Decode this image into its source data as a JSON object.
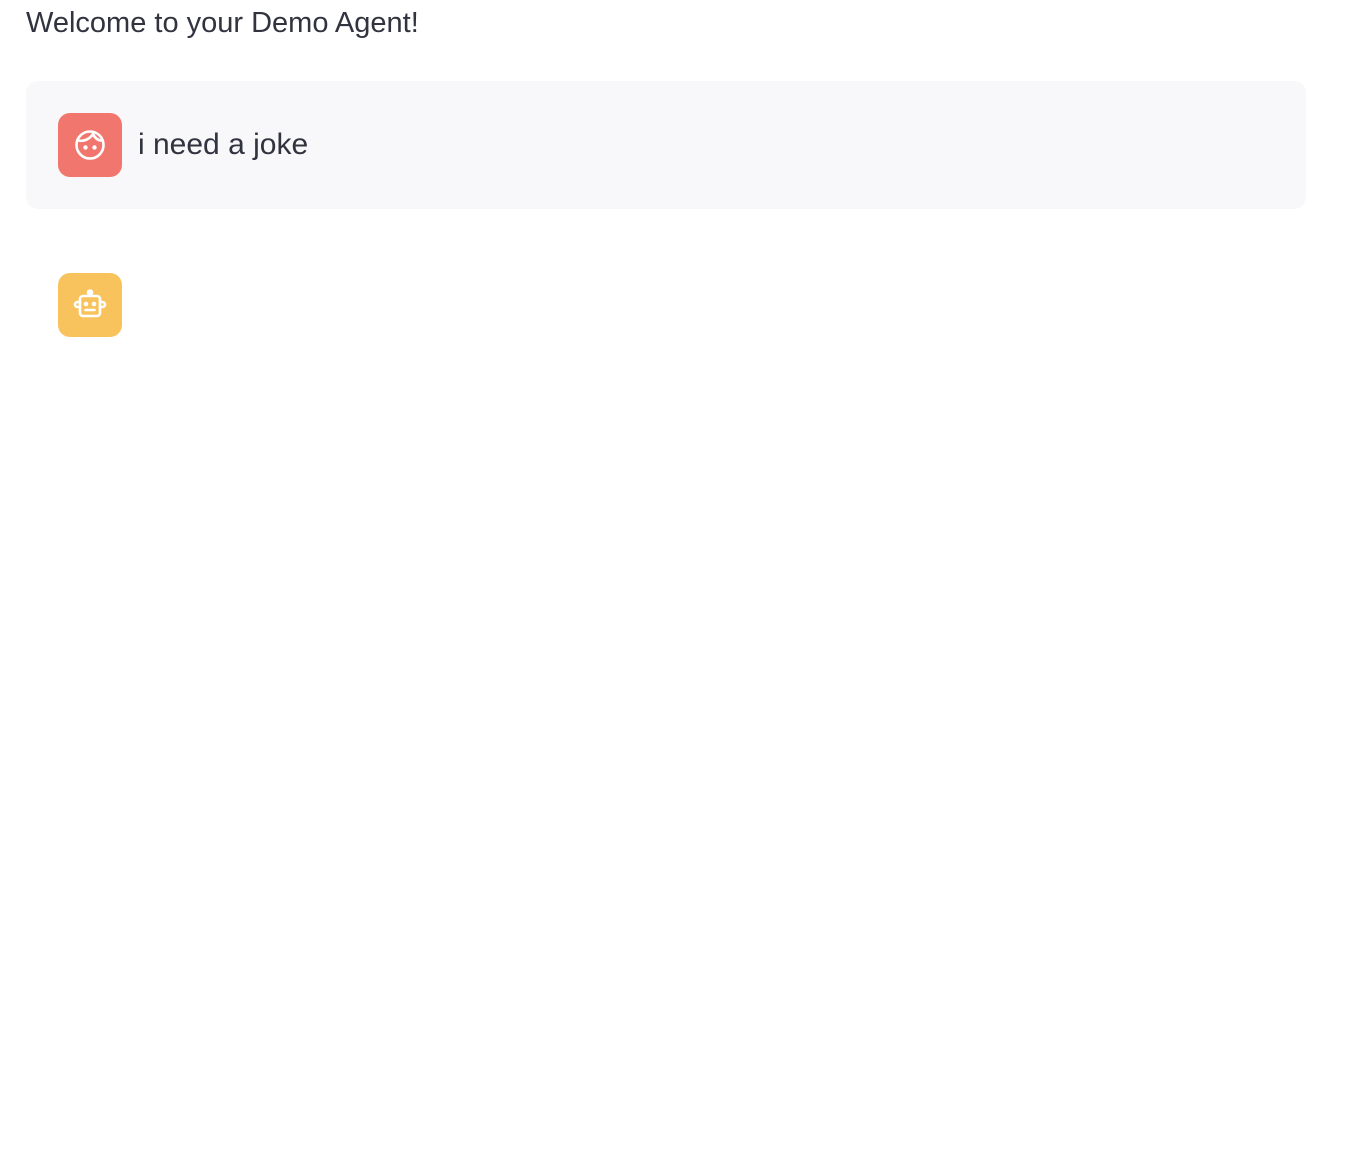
{
  "header": {
    "welcome_text": "Welcome to your Demo Agent!"
  },
  "messages": [
    {
      "role": "user",
      "avatar_icon": "user-face-icon",
      "avatar_color": "#f0766e",
      "text": "i need a joke"
    },
    {
      "role": "assistant",
      "avatar_icon": "robot-icon",
      "avatar_color": "#f8c35d",
      "text": ""
    }
  ],
  "colors": {
    "text": "#31333f",
    "user_bubble_bg": "#f8f8fa",
    "page_bg": "#ffffff"
  }
}
